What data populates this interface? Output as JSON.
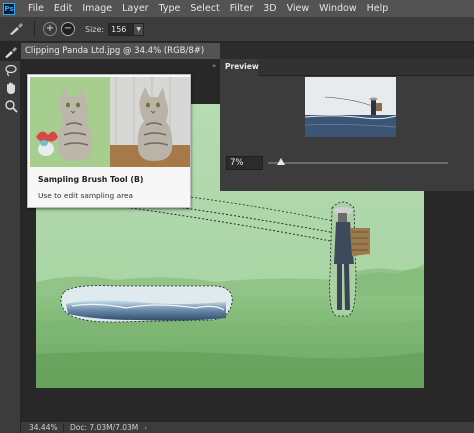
{
  "app": {
    "logo": "Ps"
  },
  "menu": [
    "File",
    "Edit",
    "Image",
    "Layer",
    "Type",
    "Select",
    "Filter",
    "3D",
    "View",
    "Window",
    "Help"
  ],
  "options": {
    "tool_icon": "sampling-brush-icon",
    "add_label": "+",
    "subtract_label": "−",
    "size_label": "Size:",
    "size_value": "156"
  },
  "toolbar": {
    "tools": [
      "sampling-brush-icon",
      "lasso-icon",
      "hand-icon",
      "zoom-icon"
    ]
  },
  "document": {
    "tab_title": "Clipping Panda Ltd.jpg @ 34.4% (RGB/8#)"
  },
  "preview": {
    "tab_label": "Preview",
    "zoom_value": "7%",
    "zoom_level": 0.07
  },
  "tooltip": {
    "title": "Sampling Brush Tool (B)",
    "description": "Use to edit sampling area"
  },
  "status": {
    "zoom": "34.44%",
    "doc": "Doc: 7.03M/7.03M"
  },
  "colors": {
    "accent": "#31a8ff",
    "panel_bg": "#3c3c3c",
    "canvas_bg": "#282828",
    "overlay_green": "#a6d6a0"
  }
}
